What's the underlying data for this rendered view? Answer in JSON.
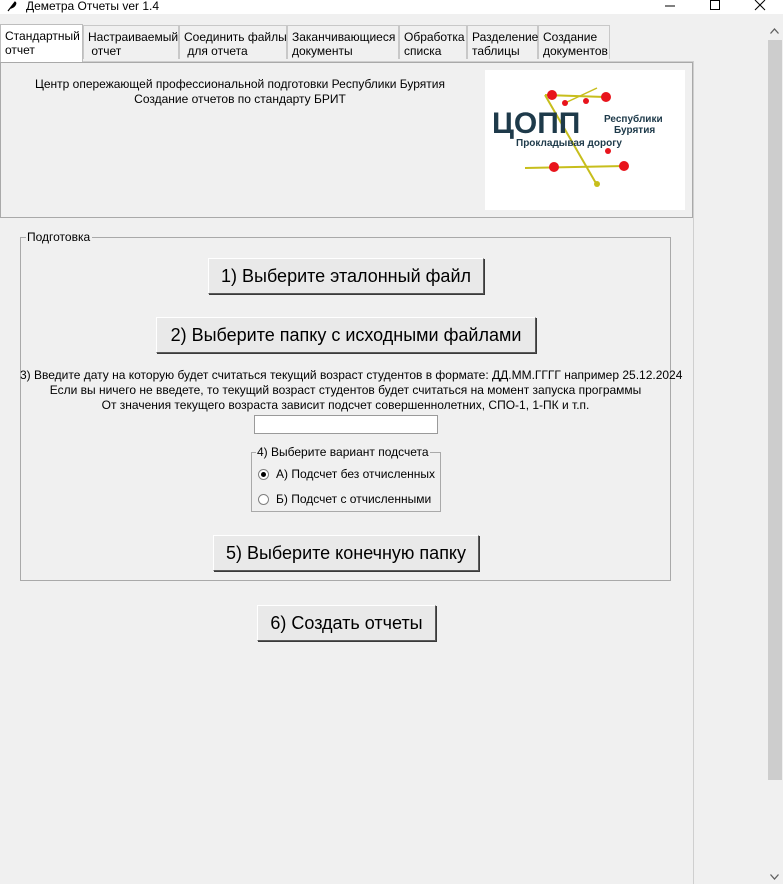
{
  "window": {
    "title": "Деметра Отчеты  ver 1.4",
    "app_icon": "feather-icon",
    "controls": [
      "minimize-icon",
      "maximize-icon",
      "close-icon"
    ]
  },
  "tabs": [
    {
      "label": "Стандартный\nотчет",
      "active": true
    },
    {
      "label": "Настраиваемый\n отчет",
      "active": false
    },
    {
      "label": "Соединить файлы\n для отчета",
      "active": false
    },
    {
      "label": "Заканчивающиеся\nдокументы",
      "active": false
    },
    {
      "label": "Обработка\nсписка",
      "active": false
    },
    {
      "label": "Разделение\nтаблицы",
      "active": false
    },
    {
      "label": "Создание\nдокументов",
      "active": false
    }
  ],
  "header": {
    "line1": "Центр опережающей профессиональной подготовки Республики Бурятия",
    "line2": "Создание отчетов по стандарту БРИТ",
    "logo": {
      "main_text": "ЦОПП",
      "side_line1": "Республики",
      "side_line2": "Бурятия",
      "slogan": "Прокладывая дорогу",
      "accent_color": "#e8141c",
      "line_color": "#c7be1c",
      "text_color": "#1e3a4a"
    }
  },
  "prep": {
    "group_label": "Подготовка",
    "btn_reference": "1) Выберите эталонный файл",
    "btn_source_folder": "2) Выберите папку с исходными файлами",
    "date_hint_1": "3) Введите дату на которую будет считаться текущий возраст студентов в формате: ДД.ММ.ГГГГ например 25.12.2024",
    "date_hint_2": "Если вы ничего не введете, то текущий возраст студентов будет считаться на момент запуска программы",
    "date_hint_3": "От значения текущего возраста зависит подсчет совершеннолетних, СПО-1, 1-ПК и т.п.",
    "date_value": "",
    "count_mode": {
      "label": "4) Выберите вариант подсчета",
      "options": [
        {
          "label": "А) Подсчет без отчисленных",
          "selected": true
        },
        {
          "label": "Б) Подсчет с отчисленными",
          "selected": false
        }
      ]
    },
    "btn_output_folder": "5) Выберите конечную папку"
  },
  "btn_create": "6) Создать отчеты"
}
